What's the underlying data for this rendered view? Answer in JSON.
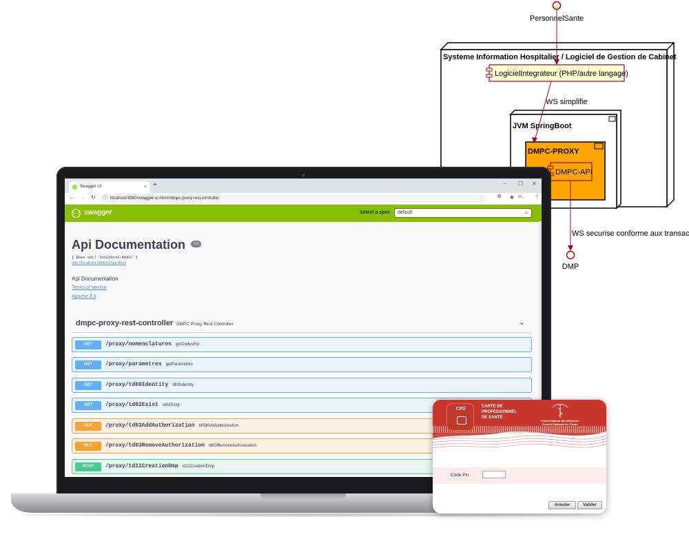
{
  "diagram": {
    "actor_top": "PersonnelSante",
    "node_outer": "Systeme Information Hospitalier / Logiciel de Gestion de Cabinet",
    "integrator": "LogicielIntegrateur (PHP/autre langage)",
    "edge_ws_simple": "WS simplifie",
    "node_jvm": "JVM SpringBoot",
    "component_proxy": "DMPC-PROXY",
    "component_api": "DMPC-API",
    "edge_ws_secure": "WS securise conforme aux transactions",
    "actor_bottom": "DMP"
  },
  "browser": {
    "tab_title": "Swagger UI",
    "tab_close": "×",
    "new_tab": "+",
    "url": "localhost:8080/swagger-ui.html#/dmpc-proxy-rest-controller",
    "profile_label": "In..."
  },
  "swagger": {
    "brand": "swagger",
    "logo_glyph": "{…}",
    "select_label": "Select a spec",
    "select_value": "default",
    "title": "Api Documentation",
    "version": "1.0",
    "base_url": "[ Base URL: localhost:8080/ ]",
    "docs_url": "http://localhost:8080/v2/api-docs",
    "description": "Api Documentation",
    "terms": "Terms of service",
    "license": "Apache 2.0",
    "controller": {
      "name": "dmpc-proxy-rest-controller",
      "description": "DMPC Proxy Rest Controller"
    },
    "operations": [
      {
        "method": "GET",
        "path": "/proxy/nomenclatures",
        "summary": "getCodesFor"
      },
      {
        "method": "GET",
        "path": "/proxy/parametres",
        "summary": "getParametres"
      },
      {
        "method": "GET",
        "path": "/proxy/td00Identity",
        "summary": "td00Identity"
      },
      {
        "method": "GET",
        "path": "/proxy/td02Exist",
        "summary": "td02Exist"
      },
      {
        "method": "PUT",
        "path": "/proxy/td03AddAuthorization",
        "summary": "td03AddAuthorization"
      },
      {
        "method": "PUT",
        "path": "/proxy/td03RemoveAuthorization",
        "summary": "td03RemoveAuthorization"
      },
      {
        "method": "POST",
        "path": "/proxy/td11CreationDmp",
        "summary": "td11CreationDmp"
      }
    ]
  },
  "cps": {
    "badge": "CPS",
    "title_line1": "CARTE DE",
    "title_line2": "PROFESSIONNEL",
    "title_line3": "DE SANTÉ",
    "order_line1": "Ordre National des Médecins",
    "order_line2": "Conseil National de l'Ordre",
    "pin_label": "Code Pin",
    "cancel": "Annuler",
    "validate": "Valider"
  },
  "colors": {
    "swagger_green": "#89bf04",
    "get": "#61affe",
    "put": "#fca130",
    "post": "#49cc90",
    "cps_red": "#c0392b",
    "proxy_orange": "#ffa500",
    "integrator_fill": "#fefece",
    "arrow": "#a80036"
  }
}
